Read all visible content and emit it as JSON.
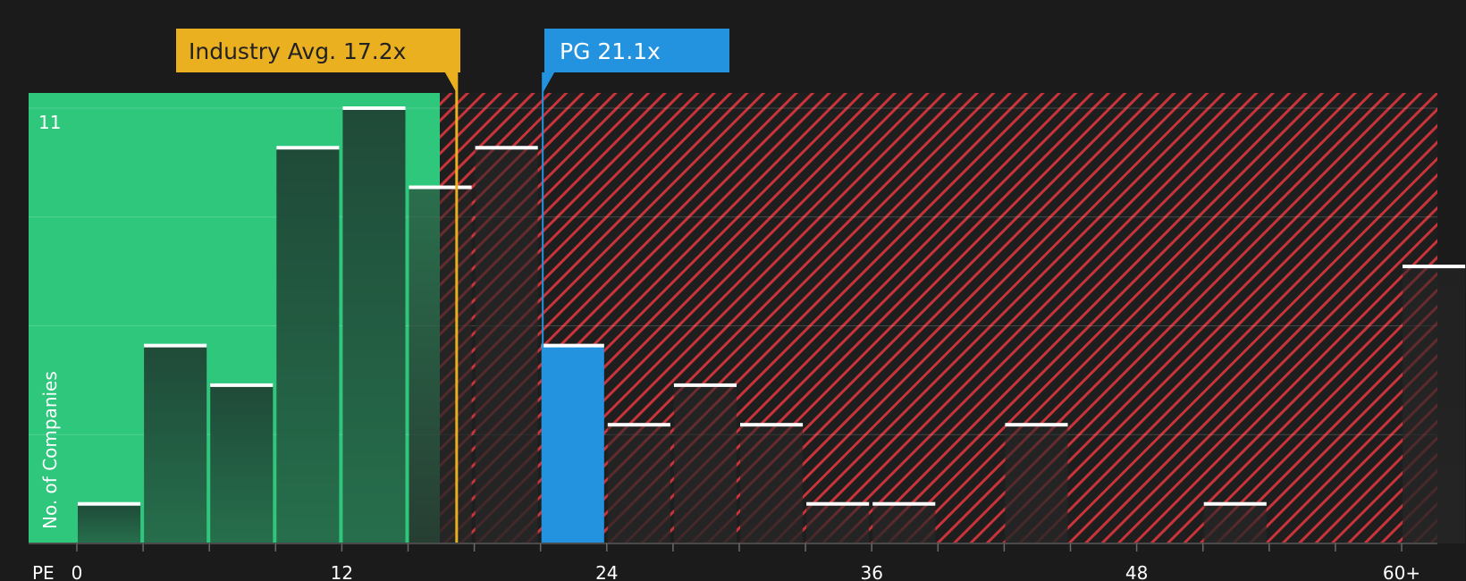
{
  "chart_data": {
    "type": "bar",
    "ylabel": "No. of Companies",
    "xlabel": "PE",
    "x_ticks": [
      "0",
      "12",
      "24",
      "36",
      "48",
      "60+"
    ],
    "y_ticks": [
      "11"
    ],
    "ylim": [
      0,
      11.4
    ],
    "grid": true,
    "bin_width": 3,
    "bins": [
      {
        "x": 1.5,
        "value": 1
      },
      {
        "x": 4.5,
        "value": 5
      },
      {
        "x": 7.5,
        "value": 4
      },
      {
        "x": 10.5,
        "value": 10
      },
      {
        "x": 13.5,
        "value": 11
      },
      {
        "x": 16.5,
        "value": 9
      },
      {
        "x": 19.5,
        "value": 10
      },
      {
        "x": 22.5,
        "value": 5,
        "highlight": true
      },
      {
        "x": 25.5,
        "value": 3
      },
      {
        "x": 28.5,
        "value": 4
      },
      {
        "x": 31.5,
        "value": 3
      },
      {
        "x": 34.5,
        "value": 1
      },
      {
        "x": 37.5,
        "value": 1
      },
      {
        "x": 43.5,
        "value": 3
      },
      {
        "x": 52.5,
        "value": 1
      },
      {
        "x": 61.5,
        "value": 7
      }
    ],
    "industry_avg": {
      "label": "Industry Avg. 17.2x",
      "value": 17.2
    },
    "company": {
      "label": "PG 21.1x",
      "value": 21.1
    },
    "colors": {
      "background": "#1b1b1b",
      "fair_zone": "#2ec77c",
      "over_zone": "#c9333a",
      "bar_top": "#1f4a38",
      "bar_bottom": "#266f4c",
      "company_bar": "#2393e0",
      "industry": "#eab01f",
      "cap": "#ffffff"
    }
  }
}
